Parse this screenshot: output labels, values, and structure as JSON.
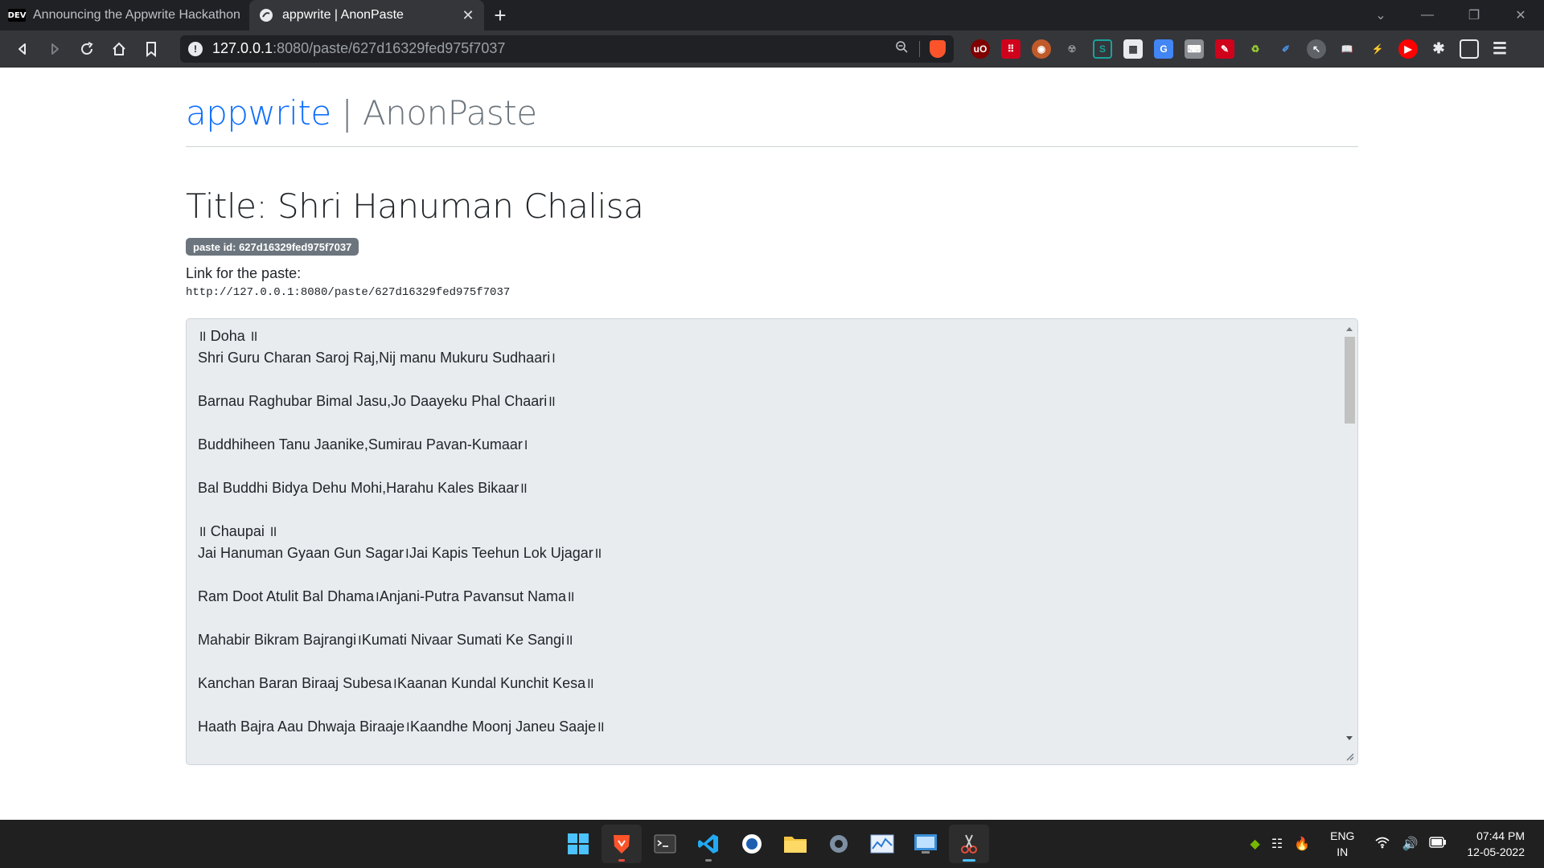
{
  "browser": {
    "tabs": [
      {
        "title": "Announcing the Appwrite Hackathon on DEV",
        "favicon": "DEV",
        "active": false
      },
      {
        "title": "appwrite | AnonPaste",
        "active": true
      }
    ],
    "new_tab": "+",
    "url": {
      "host": "127.0.0.1",
      "path": ":8080/paste/627d16329fed975f7037"
    }
  },
  "page": {
    "brand_primary": "appwrite",
    "brand_sep": " | ",
    "brand_secondary": "AnonPaste",
    "title": "Title: Shri Hanuman Chalisa",
    "badge": "paste id: 627d16329fed975f7037",
    "link_label": "Link for the paste:",
    "link_url": "http://127.0.0.1:8080/paste/627d16329fed975f7037",
    "paste_lines": [
      " ॥ Doha ॥",
      "Shri Guru Charan Saroj Raj,Nij manu Mukuru Sudhaari।",
      "",
      "Barnau Raghubar Bimal Jasu,Jo Daayeku Phal Chaari॥",
      "",
      "Buddhiheen Tanu Jaanike,Sumirau Pavan-Kumaar।",
      "",
      "Bal Buddhi Bidya Dehu Mohi,Harahu Kales Bikaar॥",
      "",
      " ॥ Chaupai ॥",
      "Jai Hanuman Gyaan Gun Sagar।Jai Kapis Teehun Lok Ujagar॥",
      "",
      "Ram Doot Atulit Bal Dhama।Anjani-Putra Pavansut Nama॥",
      "",
      "Mahabir Bikram Bajrangi।Kumati Nivaar Sumati Ke Sangi॥",
      "",
      "Kanchan Baran Biraaj Subesa।Kaanan Kundal Kunchit Kesa॥",
      "",
      "Haath Bajra Aau Dhwaja Biraaje।Kaandhe Moonj Janeu Saaje॥"
    ]
  },
  "taskbar": {
    "lang_top": "ENG",
    "lang_bottom": "IN",
    "time": "07:44 PM",
    "date": "12-05-2022"
  },
  "colors": {
    "brand_blue": "#0d6efd",
    "muted": "#6c757d",
    "textarea_bg": "#e9ecef"
  }
}
